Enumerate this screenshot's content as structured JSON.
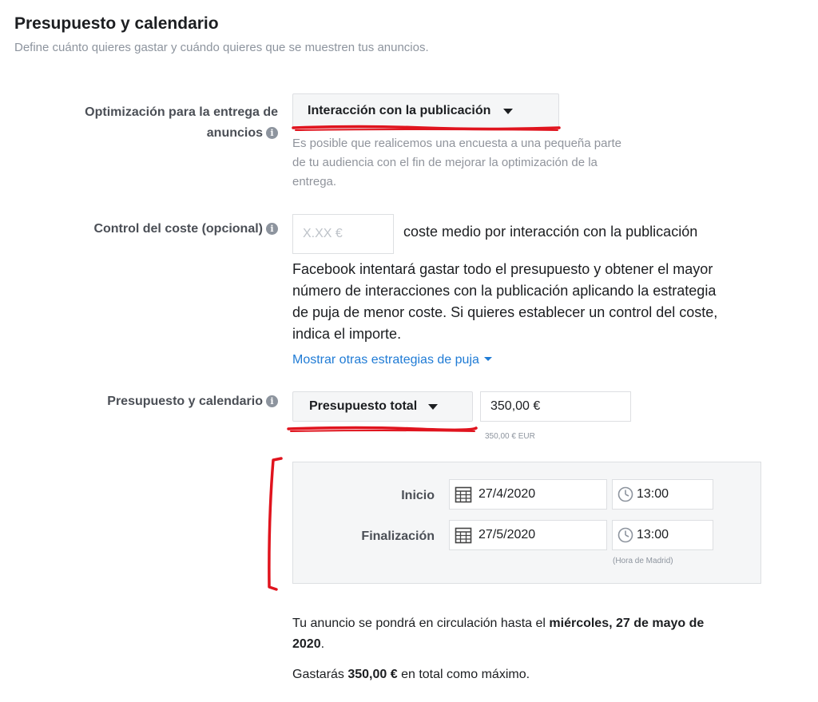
{
  "header": {
    "title": "Presupuesto y calendario",
    "subtitle": "Define cuánto quieres gastar y cuándo quieres que se muestren tus anuncios."
  },
  "optimization": {
    "label_line1": "Optimización para la entrega de",
    "label_line2": "anuncios",
    "selected": "Interacción con la publicación",
    "hint_line1": "Es posible que realicemos una encuesta a una pequeña parte",
    "hint_line2": "de tu audiencia con el fin de mejorar la optimización de la",
    "hint_line3": "entrega."
  },
  "cost_control": {
    "label": "Control del coste (opcional)",
    "placeholder": "X.XX €",
    "suffix": "coste medio por interacción con la publicación",
    "desc_line1": "Facebook intentará gastar todo el presupuesto y obtener el mayor",
    "desc_line2": "número de interacciones con la publicación aplicando la estrategia",
    "desc_line3": "de puja de menor coste. Si quieres establecer un control del coste,",
    "desc_line4": "indica el importe.",
    "link": "Mostrar otras estrategias de puja"
  },
  "budget": {
    "label": "Presupuesto y calendario",
    "type": "Presupuesto total",
    "amount": "350,00 €",
    "amount_note": "350,00 € EUR"
  },
  "schedule": {
    "start_label": "Inicio",
    "start_date": "27/4/2020",
    "start_time": "13:00",
    "end_label": "Finalización",
    "end_date": "27/5/2020",
    "end_time": "13:00",
    "timezone": "(Hora de Madrid)"
  },
  "summary": {
    "line1_prefix": "Tu anuncio se pondrá en circulación hasta el ",
    "line1_bold": "miércoles, 27 de mayo de",
    "line2_bold": "2020",
    "line2_suffix": ".",
    "spend_prefix": "Gastarás ",
    "spend_bold": "350,00 €",
    "spend_suffix": " en total como máximo."
  },
  "colors": {
    "accent_link": "#1f7bd5",
    "annotation_red": "#e0141e"
  }
}
